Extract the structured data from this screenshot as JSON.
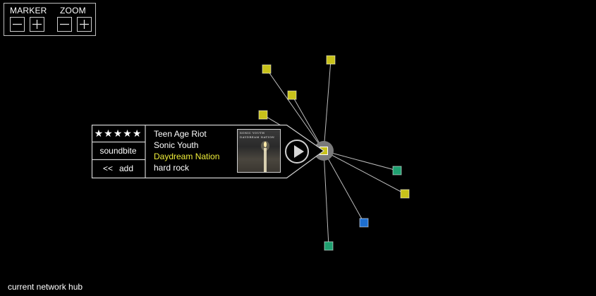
{
  "controls": {
    "marker_label": "MARKER",
    "zoom_label": "ZOOM"
  },
  "track": {
    "rating_stars": "★★★★★",
    "rating": 5,
    "soundbite_label": "soundbite",
    "add_arrows": "<<",
    "add_label": "add",
    "title": "Teen Age Riot",
    "artist": "Sonic Youth",
    "album": "Daydream Nation",
    "genre": "hard rock",
    "album_art_line1": "SONIC YOUTH",
    "album_art_line2": "DAYDREAM NATION"
  },
  "network": {
    "hub_caption": "current network hub",
    "node_colors": {
      "yellow": "#c8c21a",
      "green": "#1fa070",
      "blue": "#1e6fd0"
    },
    "nodes": [
      {
        "kind": "yellow"
      },
      {
        "kind": "yellow"
      },
      {
        "kind": "yellow"
      },
      {
        "kind": "yellow"
      },
      {
        "kind": "green"
      },
      {
        "kind": "yellow"
      },
      {
        "kind": "blue"
      },
      {
        "kind": "green"
      }
    ]
  }
}
